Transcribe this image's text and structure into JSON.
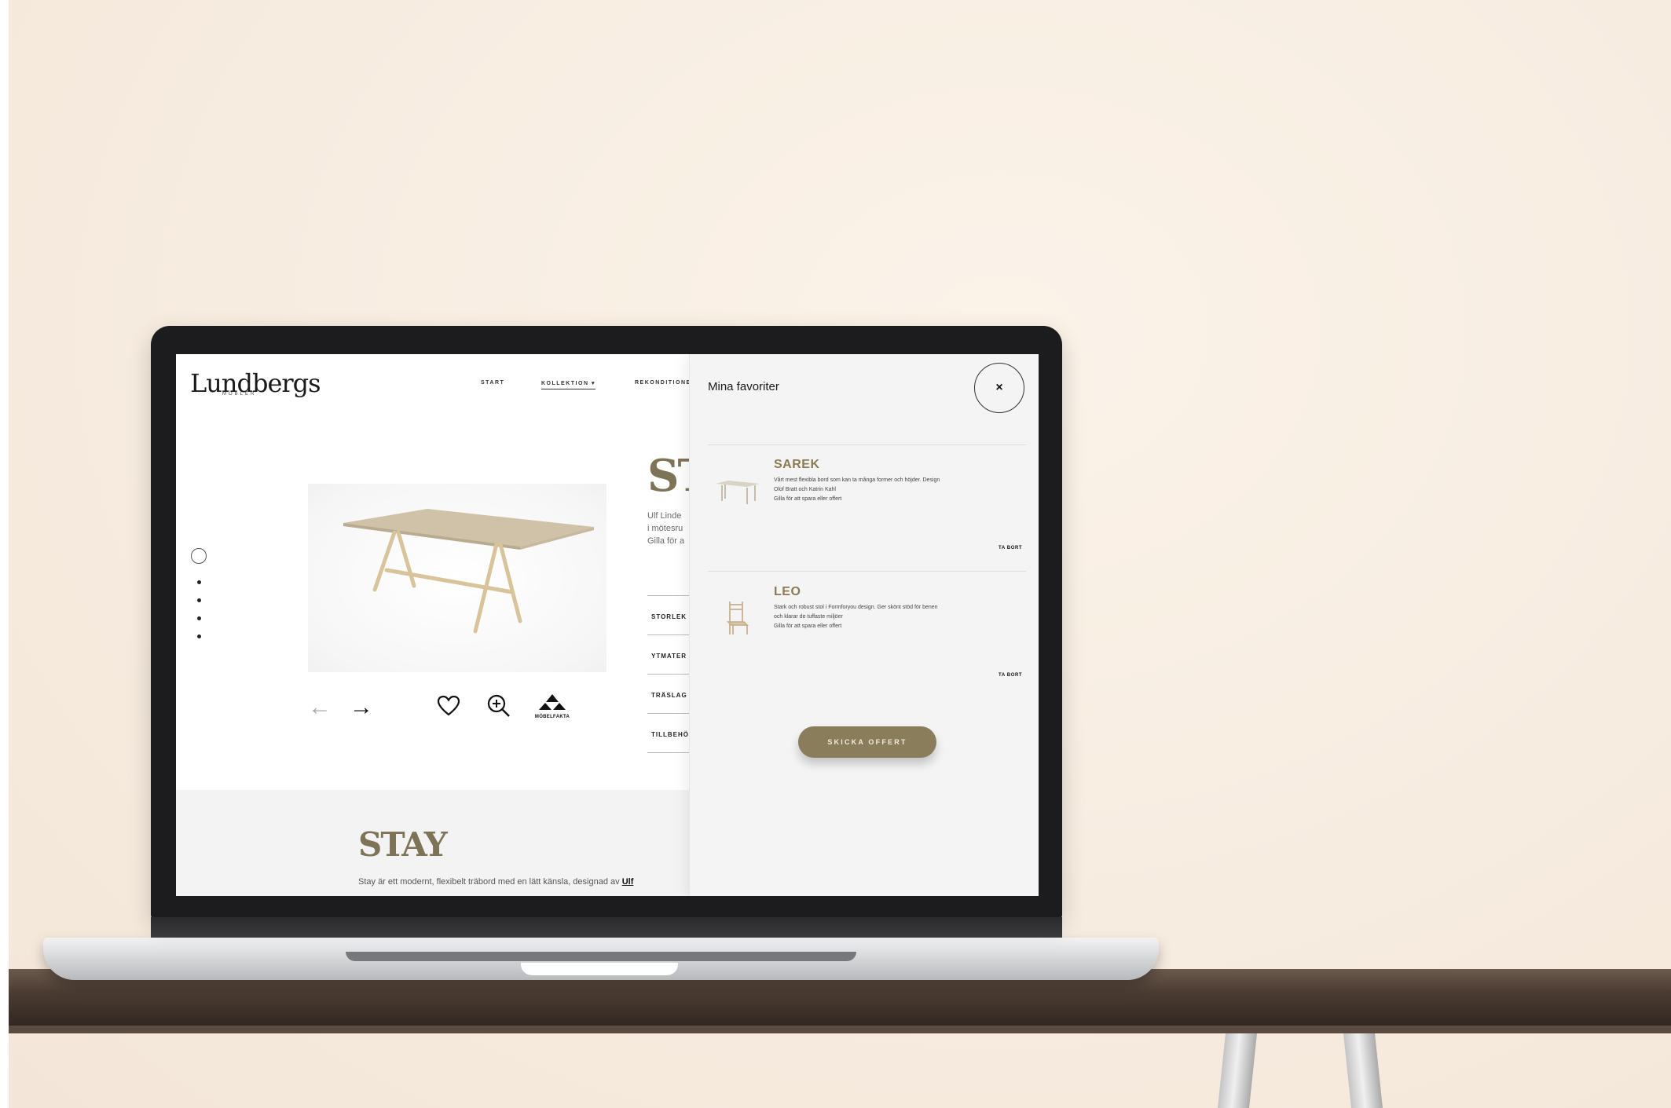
{
  "site": {
    "logo": "Lundbergs",
    "logo_sub": "MÖBLER",
    "nav": {
      "start": "START",
      "kollektion": "KOLLEKTION",
      "kollektion_chevron": "▾",
      "rekonditionering_partial": "REKONDITIONERING"
    }
  },
  "product": {
    "title_partial": "ST",
    "desc_lines": [
      "Ulf Linde",
      "i mötesru",
      "Gilla för a"
    ],
    "spec_labels": [
      "STORLEK",
      "YTMATER",
      "TRÄSLAG",
      "TILLBEHÖ"
    ],
    "controls": {
      "prev_arrow": "←",
      "next_arrow": "→",
      "heart_icon": "heart-icon",
      "zoom_icon": "zoom-in-icon",
      "mobelfakta_label": "MÖBELFAKTA"
    }
  },
  "stay_section": {
    "heading": "STAY",
    "description": "Stay är ett modernt, flexibelt träbord med en lätt känsla, designad av ",
    "description_link": "Ulf"
  },
  "favorites": {
    "title": "Mina favoriter",
    "close_label": "×",
    "items": [
      {
        "name": "SAREK",
        "desc_line1": "Vårt mest flexibla bord som kan ta många former och höjder. Design",
        "desc_line2": "Olof Bratt och Katrin Kahl",
        "desc_line3": "Gilla för att spara eller offert",
        "remove_label": "TA BORT"
      },
      {
        "name": "LEO",
        "desc_line1": "Stark och robust stol i Formforyou design. Ger skönt stöd för benen",
        "desc_line2": "och klarar de tuffaste miljöer",
        "desc_line3": "Gilla för att spara eller offert",
        "remove_label": "TA BORT"
      }
    ],
    "send_offer_label": "SKICKA OFFERT"
  },
  "colors": {
    "accent": "#8a7d5c",
    "heading_olive": "#7d7357",
    "wall": "#f7ece0",
    "laptop_bezel": "#1c1c1e"
  }
}
